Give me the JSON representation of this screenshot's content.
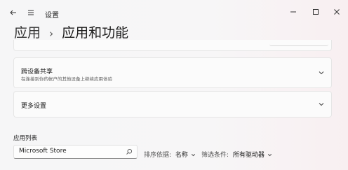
{
  "window": {
    "title": "设置",
    "nav_icons": [
      "back-arrow-icon",
      "hamburger-menu-icon"
    ],
    "controls": [
      "minimize-icon",
      "maximize-icon",
      "close-icon"
    ]
  },
  "breadcrumb": {
    "parent": "应用",
    "separator": "›",
    "current": "应用和功能"
  },
  "cards": [
    {
      "title": "跨设备共享",
      "subtitle": "在连接到你的帐户的其他设备上继续应用体验",
      "icon": "chevron-down-icon"
    },
    {
      "title": "更多设置",
      "icon": "chevron-down-icon"
    }
  ],
  "app_list": {
    "label": "应用列表",
    "search": {
      "value": "Microsoft Store",
      "icon": "search-icon"
    },
    "sort": {
      "label": "排序依据:",
      "value": "名称"
    },
    "filter": {
      "label": "筛选条件:",
      "value": "所有驱动器"
    }
  },
  "colors": {
    "background": "#f6f6f7",
    "card": "#fbfbfb",
    "border": "#e6e6e6"
  }
}
